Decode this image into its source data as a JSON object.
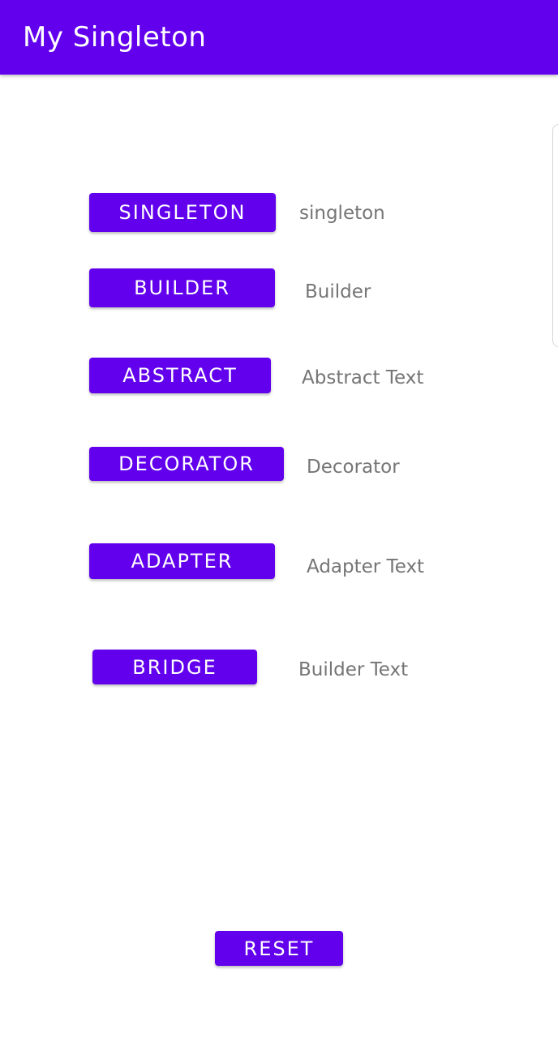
{
  "app_bar": {
    "title": "My Singleton",
    "color": "#6200ee"
  },
  "rows": [
    {
      "button_label": "SINGLETON",
      "text": "singleton"
    },
    {
      "button_label": "BUILDER",
      "text": "Builder"
    },
    {
      "button_label": "ABSTRACT",
      "text": "Abstract Text"
    },
    {
      "button_label": "DECORATOR",
      "text": "Decorator"
    },
    {
      "button_label": "ADAPTER",
      "text": "Adapter Text"
    },
    {
      "button_label": "BRIDGE",
      "text": "Builder Text"
    }
  ],
  "reset_button": {
    "label": "RESET"
  },
  "colors": {
    "accent": "#6200ee",
    "label_text": "#757575",
    "background": "#ffffff"
  }
}
